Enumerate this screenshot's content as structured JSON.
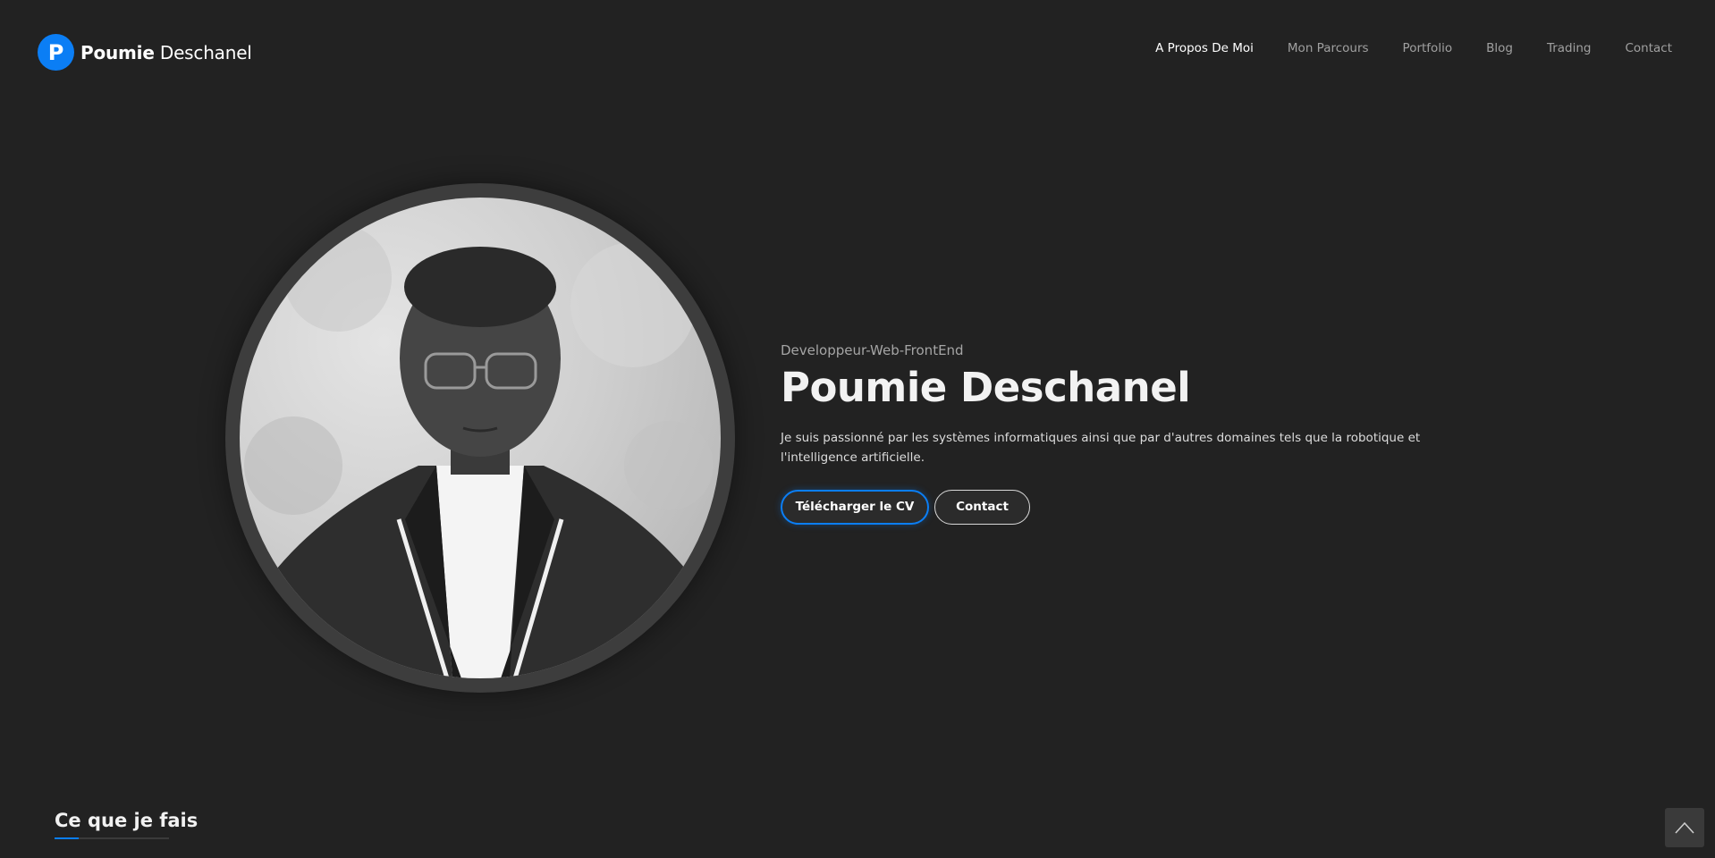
{
  "brand": {
    "initial": "P",
    "first": "Poumie",
    "last": "Deschanel",
    "color": "#0b7ef5"
  },
  "nav": {
    "items": [
      {
        "label": "A Propos De Moi",
        "active": true
      },
      {
        "label": "Mon Parcours",
        "active": false
      },
      {
        "label": "Portfolio",
        "active": false
      },
      {
        "label": "Blog",
        "active": false
      },
      {
        "label": "Trading",
        "active": false
      },
      {
        "label": "Contact",
        "active": false
      }
    ]
  },
  "hero": {
    "subtitle": "Developpeur-Web-FrontEnd",
    "title": "Poumie Deschanel",
    "description": "Je suis passionné par les systèmes informatiques ainsi que par d'autres domaines tels que la robotique et l'intelligence artificielle.",
    "cv_button": "Télécharger le CV",
    "contact_button": "Contact"
  },
  "section": {
    "title": "Ce que je fais"
  },
  "icons": {
    "scroll_top": "chevron-up-icon"
  },
  "colors": {
    "background": "#222222",
    "accent": "#0b7ef5"
  }
}
